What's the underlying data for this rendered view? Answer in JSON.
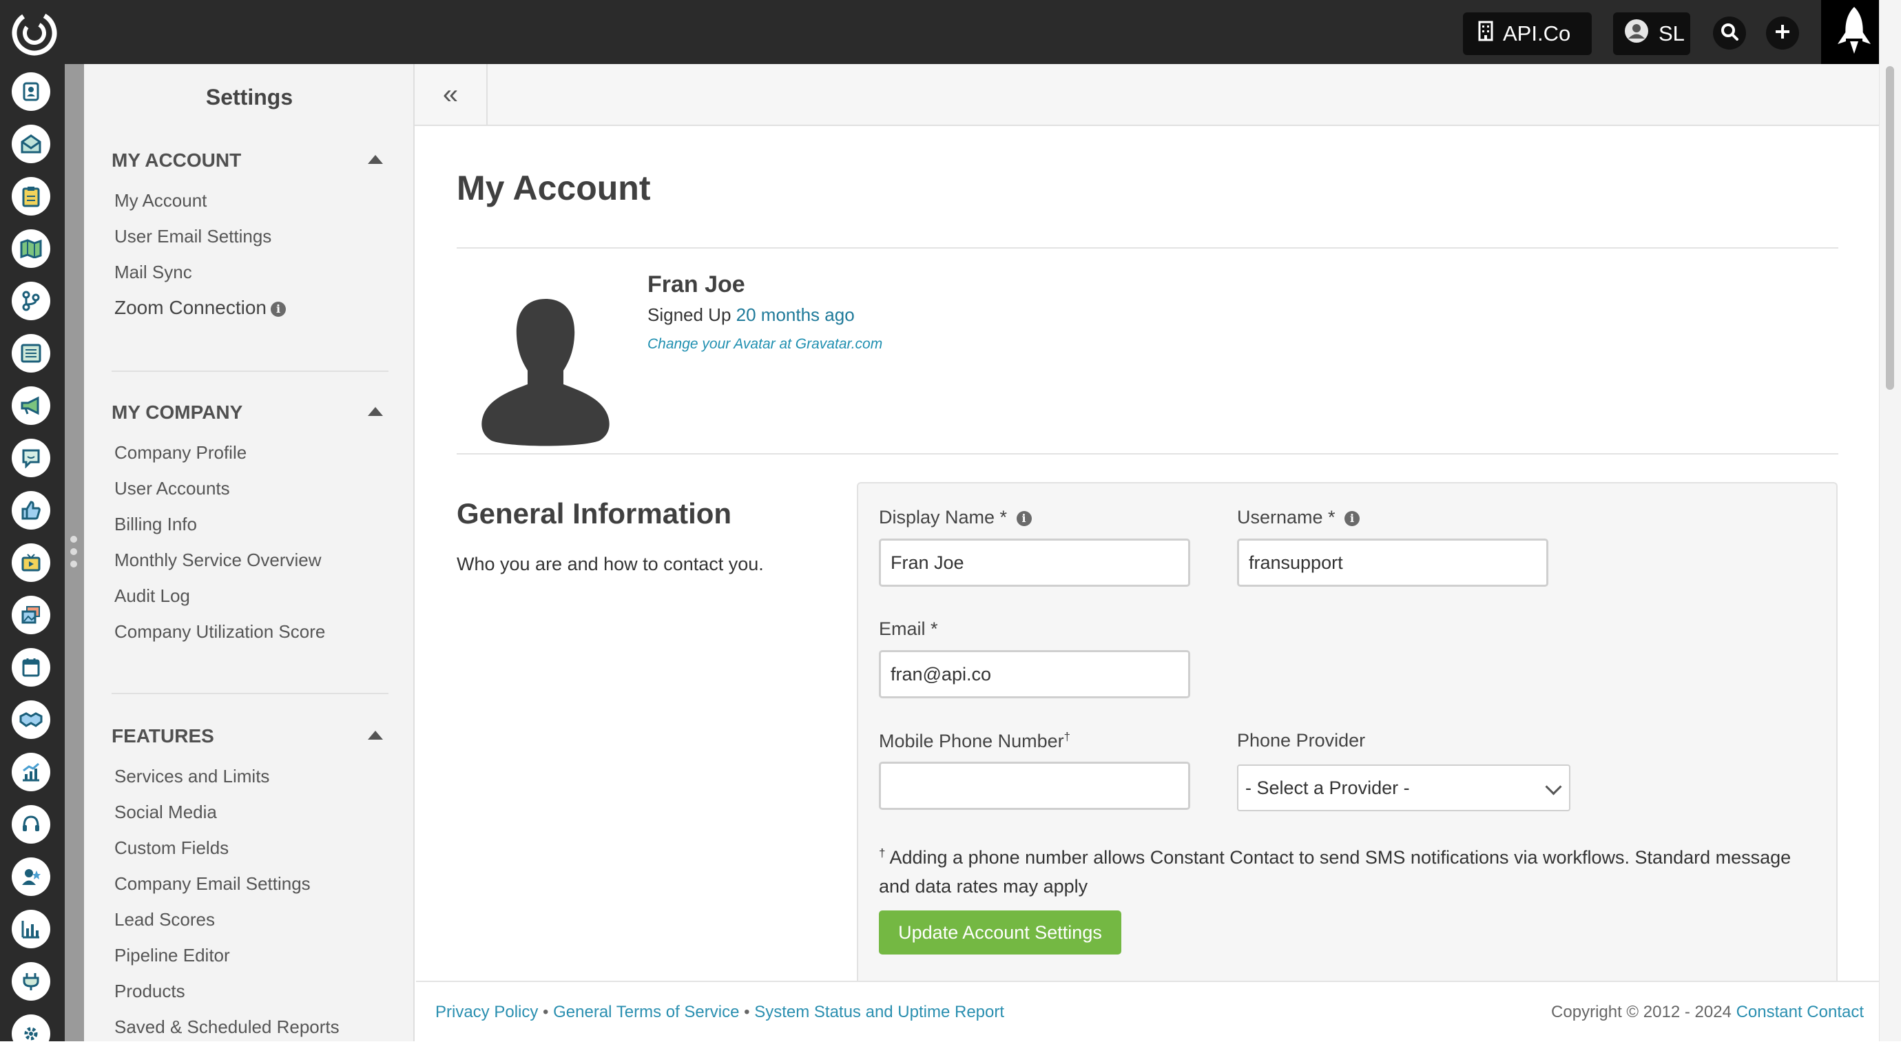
{
  "topbar": {
    "company_label": "API.Co",
    "user_initials": "SL",
    "icons": [
      "app-logo-icon",
      "building-icon",
      "user-circle-icon",
      "search-icon",
      "plus-icon",
      "rocket-icon"
    ]
  },
  "rail": {
    "icons": [
      "contacts-icon",
      "mail-icon",
      "clipboard-icon",
      "map-icon",
      "workflow-icon",
      "list-icon",
      "megaphone-icon",
      "chat-icon",
      "thumbs-up-icon",
      "video-icon",
      "media-icon",
      "calendar-icon",
      "handshake-icon",
      "trend-chart-icon",
      "headset-icon",
      "user-star-icon",
      "bar-chart-icon",
      "plug-icon",
      "gear-icon"
    ]
  },
  "sidebar": {
    "title": "Settings",
    "sections": [
      {
        "heading": "MY ACCOUNT",
        "items": [
          "My Account",
          "User Email Settings",
          "Mail Sync",
          "Zoom Connection"
        ]
      },
      {
        "heading": "MY COMPANY",
        "items": [
          "Company Profile",
          "User Accounts",
          "Billing Info",
          "Monthly Service Overview",
          "Audit Log",
          "Company Utilization Score"
        ]
      },
      {
        "heading": "FEATURES",
        "items": [
          "Services and Limits",
          "Social Media",
          "Custom Fields",
          "Company Email Settings",
          "Lead Scores",
          "Pipeline Editor",
          "Products",
          "Saved & Scheduled Reports"
        ]
      }
    ]
  },
  "main": {
    "collapse_glyph": "«",
    "page_title": "My Account",
    "profile": {
      "name": "Fran Joe",
      "signed_up_prefix": "Signed Up",
      "signed_up_relative": "20 months ago",
      "gravatar_link": "Change your Avatar at Gravatar.com"
    },
    "general_info": {
      "title": "General Information",
      "subtitle": "Who you are and how to contact you."
    },
    "form": {
      "display_name_label": "Display Name *",
      "display_name_value": "Fran Joe",
      "username_label": "Username *",
      "username_value": "fransupport",
      "email_label": "Email *",
      "email_value": "fran@api.co",
      "mobile_label": "Mobile Phone Number",
      "mobile_sup": "†",
      "mobile_value": "",
      "provider_label": "Phone Provider",
      "provider_selected": "- Select a Provider -",
      "note_mark": "†",
      "note_text": " Adding a phone number allows Constant Contact to send SMS notifications via workflows. Standard message and data rates may apply",
      "submit_label": "Update Account Settings"
    }
  },
  "footer": {
    "privacy": "Privacy Policy",
    "sep": "•",
    "terms": "General Terms of Service",
    "status": "System Status and Uptime Report",
    "copyright": "Copyright © 2012 - 2024",
    "brand": "Constant Contact"
  }
}
